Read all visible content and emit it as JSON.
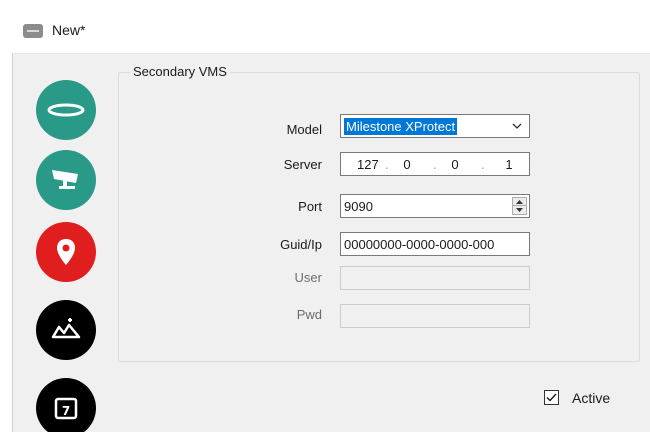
{
  "window": {
    "title": "New*"
  },
  "sidebar": {
    "items": [
      {
        "icon": "dome-camera-icon",
        "color": "#2a9a88"
      },
      {
        "icon": "cctv-camera-icon",
        "color": "#2a9a88"
      },
      {
        "icon": "map-pin-icon",
        "color": "#e01e1e"
      },
      {
        "icon": "map-icon",
        "color": "#000000"
      },
      {
        "icon": "calendar-icon",
        "color": "#000000"
      }
    ]
  },
  "group": {
    "title": "Secondary VMS"
  },
  "form": {
    "model": {
      "label": "Model",
      "value": "Milestone XProtect"
    },
    "server": {
      "label": "Server",
      "octets": [
        "127",
        "0",
        "0",
        "1"
      ]
    },
    "port": {
      "label": "Port",
      "value": "9090"
    },
    "guid": {
      "label": "Guid/Ip",
      "value": "00000000-0000-0000-000"
    },
    "user": {
      "label": "User",
      "value": ""
    },
    "pwd": {
      "label": "Pwd",
      "value": ""
    }
  },
  "active": {
    "label": "Active",
    "checked": true
  },
  "colors": {
    "accent": "#0078d7",
    "teal": "#2a9a88",
    "red": "#e01e1e"
  }
}
